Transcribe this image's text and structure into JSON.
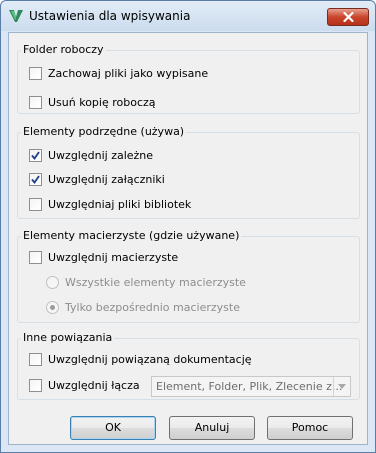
{
  "window": {
    "title": "Ustawienia dla wpisywania",
    "icons": {
      "app": "vault-v-icon",
      "close": "close-x-icon"
    }
  },
  "groups": {
    "folder": {
      "label": "Folder roboczy",
      "options": [
        {
          "label": "Zachowaj pliki jako wypisane",
          "checked": false
        },
        {
          "label": "Usuń kopię roboczą",
          "checked": false
        }
      ]
    },
    "children": {
      "label": "Elementy podrzędne (używa)",
      "options": [
        {
          "label": "Uwzględnij zależne",
          "checked": true
        },
        {
          "label": "Uwzględnij załączniki",
          "checked": true
        },
        {
          "label": "Uwzględniaj pliki bibliotek",
          "checked": false
        }
      ]
    },
    "parents": {
      "label": "Elementy macierzyste (gdzie używane)",
      "include": {
        "label": "Uwzględnij macierzyste",
        "checked": false
      },
      "radios": [
        {
          "label": "Wszystkie elementy macierzyste",
          "selected": false,
          "enabled": false
        },
        {
          "label": "Tylko bezpośrednio macierzyste",
          "selected": true,
          "enabled": false
        }
      ]
    },
    "other": {
      "label": "Inne powiązania",
      "options": [
        {
          "label": "Uwzględnij powiązaną dokumentację",
          "checked": false
        },
        {
          "label": "Uwzględnij łącza",
          "checked": false
        }
      ],
      "links_combo": {
        "value": "Element, Folder, Plik, Zlecenie z...",
        "enabled": false
      }
    }
  },
  "buttons": {
    "ok": "OK",
    "cancel": "Anuluj",
    "help": "Pomoc"
  },
  "colors": {
    "titlebar": "#cbdcee",
    "close_button": "#c9452c",
    "check": "#1d3f8a",
    "default_button_border": "#3c7fb1"
  }
}
